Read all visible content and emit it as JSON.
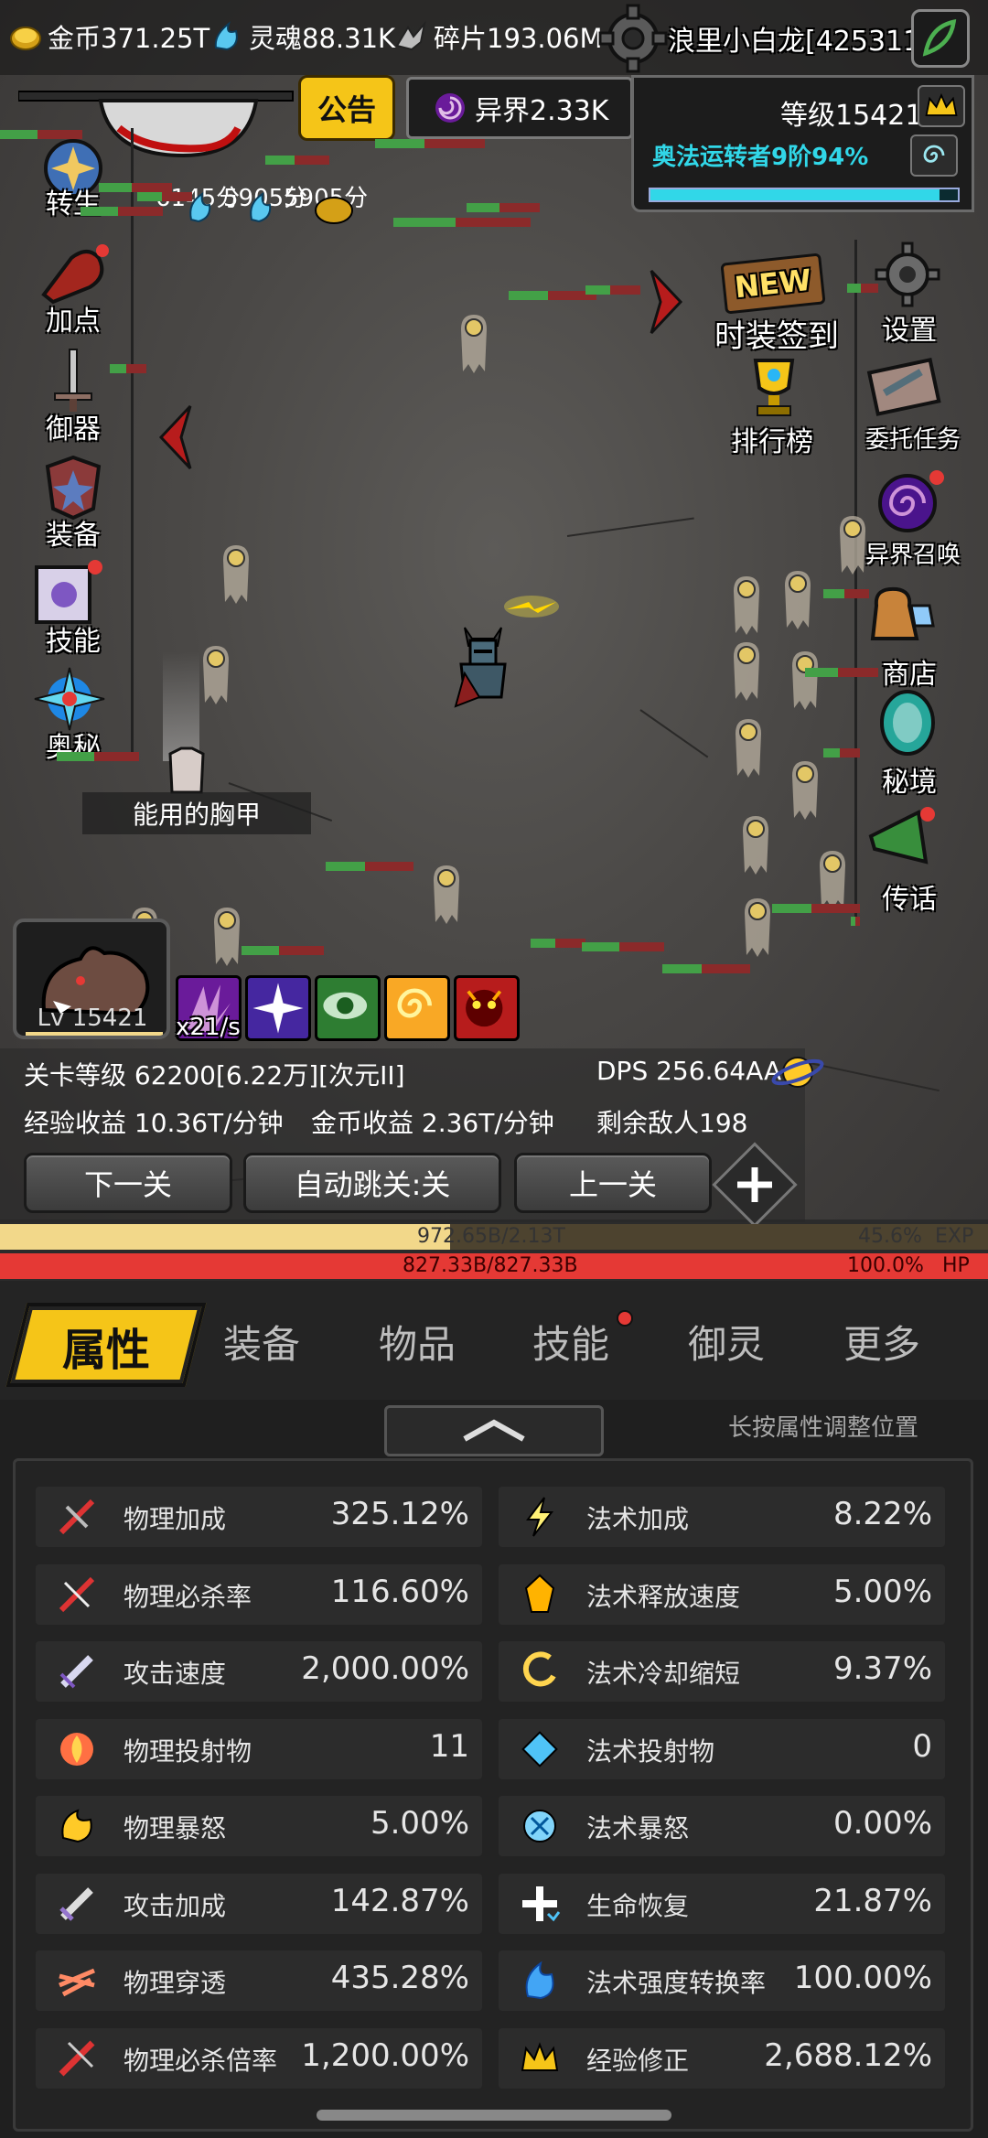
{
  "resources": {
    "gold": "金币371.25T",
    "soul": "灵魂88.31K",
    "shard": "碎片193.06M"
  },
  "player": {
    "name": "浪里小白龙[425311]",
    "level": "等级15421",
    "arcane_title": "奥法运转者9阶94%",
    "arcane_progress": 0.94,
    "hero_level": "Lv 15421"
  },
  "notice_label": "公告",
  "otherworld_label": "异界2.33K",
  "floating_texts": [
    "6145分",
    "5905分",
    "5905分"
  ],
  "left_menu": [
    "转生",
    "加点",
    "御器",
    "装备",
    "技能",
    "奥秘"
  ],
  "right_menu": {
    "costume_checkin": "时装签到",
    "new_badge": "NEW",
    "settings": "设置",
    "ranking": "排行榜",
    "commission": "委托任务",
    "otherworld_summon": "异界召唤",
    "shop": "商店",
    "secret_realm": "秘境",
    "message": "传话"
  },
  "drop_item": "能用的胸甲",
  "skill_rate": "x21/s",
  "stage": {
    "level": "关卡等级 62200[6.22万][次元II]",
    "dps": "DPS  256.64AA",
    "exp_income": "经验收益 10.36T/分钟",
    "gold_income": "金币收益 2.36T/分钟",
    "enemies_left": "剩余敌人198"
  },
  "nav": {
    "next": "下一关",
    "auto_skip": "自动跳关:关",
    "prev": "上一关"
  },
  "exp_bar": {
    "value": "972.65B/2.13T",
    "percent_text": "45.6%",
    "label": "EXP",
    "fraction": 0.456
  },
  "hp_bar": {
    "value": "827.33B/827.33B",
    "percent_text": "100.0%",
    "label": "HP",
    "fraction": 1.0
  },
  "tabs": [
    "属性",
    "装备",
    "物品",
    "技能",
    "御灵",
    "更多"
  ],
  "hint": "长按属性调整位置",
  "stats_left": [
    {
      "name": "物理加成",
      "value": "325.12%",
      "icon": "slash-icon"
    },
    {
      "name": "物理必杀率",
      "value": "116.60%",
      "icon": "crit-slash-icon"
    },
    {
      "name": "攻击速度",
      "value": "2,000.00%",
      "icon": "sword-speed-icon"
    },
    {
      "name": "物理投射物",
      "value": "11",
      "icon": "fire-projectile-icon"
    },
    {
      "name": "物理暴怒",
      "value": "5.00%",
      "icon": "rage-icon"
    },
    {
      "name": "攻击加成",
      "value": "142.87%",
      "icon": "sword-icon"
    },
    {
      "name": "物理穿透",
      "value": "435.28%",
      "icon": "pierce-icon"
    },
    {
      "name": "物理必杀倍率",
      "value": "1,200.00%",
      "icon": "crit-multi-icon"
    }
  ],
  "stats_right": [
    {
      "name": "法术加成",
      "value": "8.22%",
      "icon": "lightning-icon"
    },
    {
      "name": "法术释放速度",
      "value": "5.00%",
      "icon": "cast-speed-icon"
    },
    {
      "name": "法术冷却缩短",
      "value": "9.37%",
      "icon": "cooldown-icon"
    },
    {
      "name": "法术投射物",
      "value": "0",
      "icon": "magic-projectile-icon"
    },
    {
      "name": "法术暴怒",
      "value": "0.00%",
      "icon": "magic-rage-icon"
    },
    {
      "name": "生命恢复",
      "value": "21.87%",
      "icon": "heal-icon"
    },
    {
      "name": "法术强度转换率",
      "value": "100.00%",
      "icon": "blue-flame-icon"
    },
    {
      "name": "经验修正",
      "value": "2,688.12%",
      "icon": "crown-icon"
    }
  ],
  "colors": {
    "exp": "#f2d88a",
    "hp": "#e53935",
    "arcane_bar": "#31d7e8",
    "gold": "#f5c518",
    "tab_active": "#f5c518"
  }
}
